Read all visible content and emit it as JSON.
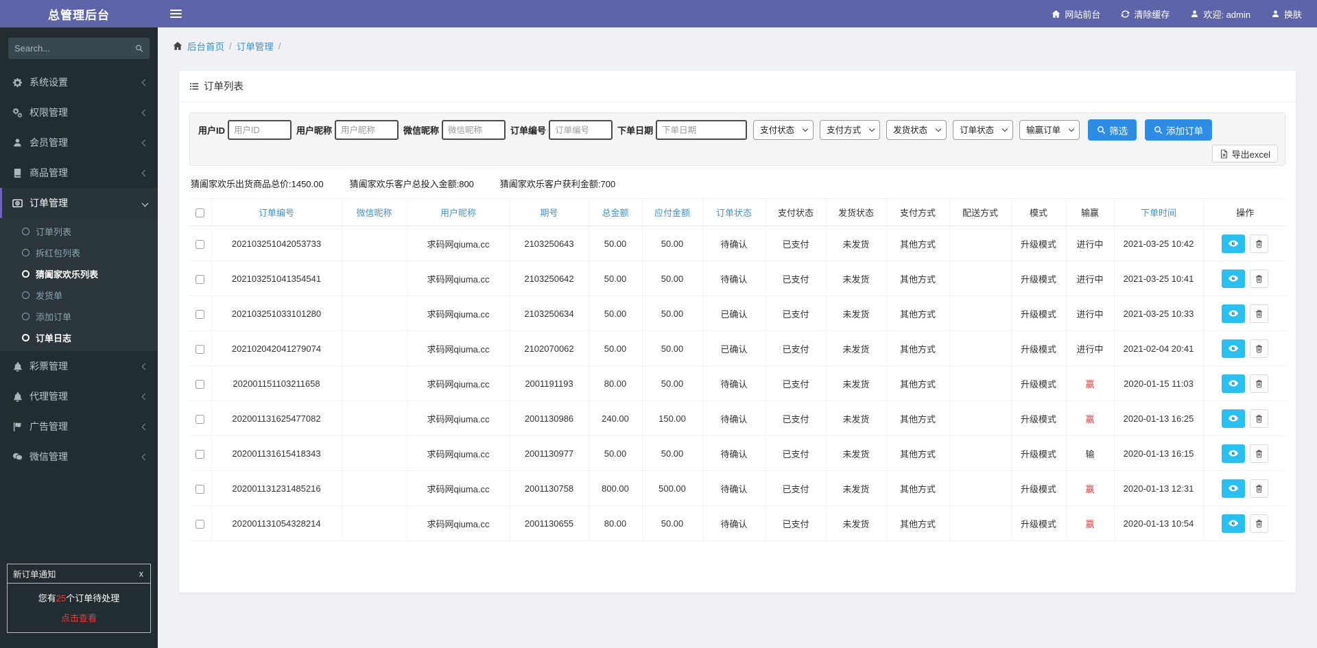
{
  "theme": {
    "topbar_purple": "#5e64a8",
    "sidebar_dark": "#222d32",
    "accent_purple": "#6f63c0",
    "link_blue": "#3d8fd0",
    "header_link_blue": "#4193d2",
    "button_blue": "#2e8ce4",
    "eye_cyan": "#29bff0",
    "alert_red": "#e53c3c"
  },
  "topbar": {
    "brand": "总管理后台",
    "nav": [
      {
        "name": "site-front-link",
        "icon": "home",
        "label": "网站前台"
      },
      {
        "name": "clear-cache-link",
        "icon": "refresh",
        "label": "清除缓存"
      },
      {
        "name": "welcome-admin",
        "icon": "person",
        "label": "欢迎: admin"
      },
      {
        "name": "change-skin-link",
        "icon": "person",
        "label": "换肤"
      }
    ]
  },
  "sidebar": {
    "search_placeholder": "Search...",
    "items": [
      {
        "name": "system-settings",
        "icon": "gear",
        "label": "系统设置",
        "active": false
      },
      {
        "name": "permission-management",
        "icon": "gears",
        "label": "权限管理",
        "active": false
      },
      {
        "name": "member-management",
        "icon": "person",
        "label": "会员管理",
        "active": false
      },
      {
        "name": "product-management",
        "icon": "book",
        "label": "商品管理",
        "active": false
      },
      {
        "name": "order-management",
        "icon": "order",
        "label": "订单管理",
        "active": true
      },
      {
        "name": "lottery-management",
        "icon": "bell",
        "label": "彩票管理",
        "active": false
      },
      {
        "name": "agent-management",
        "icon": "bell",
        "label": "代理管理",
        "active": false
      },
      {
        "name": "ad-management",
        "icon": "flag",
        "label": "广告管理",
        "active": false
      },
      {
        "name": "wechat-management",
        "icon": "wechat",
        "label": "微信管理",
        "active": false
      }
    ],
    "submenu": [
      {
        "label": "订单列表",
        "active": false
      },
      {
        "label": "拆红包列表",
        "active": false
      },
      {
        "label": "猜阖家欢乐列表",
        "active": true
      },
      {
        "label": "发货单",
        "active": false
      },
      {
        "label": "添加订单",
        "active": false
      },
      {
        "label": "订单日志",
        "active": true
      }
    ]
  },
  "notification": {
    "title": "新订单通知",
    "close_label": "x",
    "message_prefix": "您有",
    "pending_count": "25",
    "message_suffix": "个订单待处理",
    "action": "点击查看"
  },
  "breadcrumb": {
    "home": "后台首页",
    "section": "订单管理",
    "separator": "/"
  },
  "card": {
    "title": "订单列表"
  },
  "filters": {
    "fields": [
      {
        "name": "user-id",
        "label": "用户ID",
        "placeholder": "用户ID",
        "wide": false
      },
      {
        "name": "user-nickname",
        "label": "用户昵称",
        "placeholder": "用户昵称",
        "wide": false
      },
      {
        "name": "wechat-nickname",
        "label": "微信昵称",
        "placeholder": "微信昵称",
        "wide": false
      },
      {
        "name": "order-no",
        "label": "订单编号",
        "placeholder": "订单编号",
        "wide": false
      },
      {
        "name": "order-date",
        "label": "下单日期",
        "placeholder": "下单日期",
        "wide": true
      }
    ],
    "selects": [
      {
        "name": "pay-status",
        "label": "支付状态"
      },
      {
        "name": "pay-method",
        "label": "支付方式"
      },
      {
        "name": "ship-status",
        "label": "发货状态"
      },
      {
        "name": "order-status",
        "label": "订单状态"
      },
      {
        "name": "win-lose-order",
        "label": "输赢订单"
      }
    ],
    "buttons": {
      "filter": "筛选",
      "add": "添加订单",
      "export": "导出excel"
    }
  },
  "stats": [
    "猜阖家欢乐出货商品总价:1450.00",
    "猜阖家欢乐客户总投入金额:800",
    "猜阖家欢乐客户获利金额:700"
  ],
  "table": {
    "columns": [
      {
        "label": "",
        "link": false
      },
      {
        "label": "订单编号",
        "link": true
      },
      {
        "label": "微信昵称",
        "link": true
      },
      {
        "label": "用户昵称",
        "link": true
      },
      {
        "label": "期号",
        "link": true
      },
      {
        "label": "总金额",
        "link": true
      },
      {
        "label": "应付金额",
        "link": true
      },
      {
        "label": "订单状态",
        "link": true
      },
      {
        "label": "支付状态",
        "link": false
      },
      {
        "label": "发货状态",
        "link": false
      },
      {
        "label": "支付方式",
        "link": false
      },
      {
        "label": "配送方式",
        "link": false
      },
      {
        "label": "模式",
        "link": false
      },
      {
        "label": "输赢",
        "link": false
      },
      {
        "label": "下单时间",
        "link": true
      },
      {
        "label": "操作",
        "link": false
      }
    ],
    "rows": [
      {
        "order_no": "202103251042053733",
        "wechat_nick": "",
        "user_nick": "求码网qiuma.cc",
        "issue": "2103250643",
        "total": "50.00",
        "payable": "50.00",
        "order_status": "待确认",
        "pay_status": "已支付",
        "ship_status": "未发货",
        "pay_method": "其他方式",
        "delivery": "",
        "mode": "升级模式",
        "win_lose": "进行中",
        "win_red": false,
        "time": "2021-03-25 10:42"
      },
      {
        "order_no": "202103251041354541",
        "wechat_nick": "",
        "user_nick": "求码网qiuma.cc",
        "issue": "2103250642",
        "total": "50.00",
        "payable": "50.00",
        "order_status": "待确认",
        "pay_status": "已支付",
        "ship_status": "未发货",
        "pay_method": "其他方式",
        "delivery": "",
        "mode": "升级模式",
        "win_lose": "进行中",
        "win_red": false,
        "time": "2021-03-25 10:41"
      },
      {
        "order_no": "202103251033101280",
        "wechat_nick": "",
        "user_nick": "求码网qiuma.cc",
        "issue": "2103250634",
        "total": "50.00",
        "payable": "50.00",
        "order_status": "已确认",
        "pay_status": "已支付",
        "ship_status": "未发货",
        "pay_method": "其他方式",
        "delivery": "",
        "mode": "升级模式",
        "win_lose": "进行中",
        "win_red": false,
        "time": "2021-03-25 10:33"
      },
      {
        "order_no": "202102042041279074",
        "wechat_nick": "",
        "user_nick": "求码网qiuma.cc",
        "issue": "2102070062",
        "total": "50.00",
        "payable": "50.00",
        "order_status": "已确认",
        "pay_status": "已支付",
        "ship_status": "未发货",
        "pay_method": "其他方式",
        "delivery": "",
        "mode": "升级模式",
        "win_lose": "进行中",
        "win_red": false,
        "time": "2021-02-04 20:41"
      },
      {
        "order_no": "202001151103211658",
        "wechat_nick": "",
        "user_nick": "求码网qiuma.cc",
        "issue": "2001191193",
        "total": "80.00",
        "payable": "50.00",
        "order_status": "待确认",
        "pay_status": "已支付",
        "ship_status": "未发货",
        "pay_method": "其他方式",
        "delivery": "",
        "mode": "升级模式",
        "win_lose": "赢",
        "win_red": true,
        "time": "2020-01-15 11:03"
      },
      {
        "order_no": "202001131625477082",
        "wechat_nick": "",
        "user_nick": "求码网qiuma.cc",
        "issue": "2001130986",
        "total": "240.00",
        "payable": "150.00",
        "order_status": "待确认",
        "pay_status": "已支付",
        "ship_status": "未发货",
        "pay_method": "其他方式",
        "delivery": "",
        "mode": "升级模式",
        "win_lose": "赢",
        "win_red": true,
        "time": "2020-01-13 16:25"
      },
      {
        "order_no": "202001131615418343",
        "wechat_nick": "",
        "user_nick": "求码网qiuma.cc",
        "issue": "2001130977",
        "total": "50.00",
        "payable": "50.00",
        "order_status": "待确认",
        "pay_status": "已支付",
        "ship_status": "未发货",
        "pay_method": "其他方式",
        "delivery": "",
        "mode": "升级模式",
        "win_lose": "输",
        "win_red": false,
        "time": "2020-01-13 16:15"
      },
      {
        "order_no": "202001131231485216",
        "wechat_nick": "",
        "user_nick": "求码网qiuma.cc",
        "issue": "2001130758",
        "total": "800.00",
        "payable": "500.00",
        "order_status": "待确认",
        "pay_status": "已支付",
        "ship_status": "未发货",
        "pay_method": "其他方式",
        "delivery": "",
        "mode": "升级模式",
        "win_lose": "赢",
        "win_red": true,
        "time": "2020-01-13 12:31"
      },
      {
        "order_no": "202001131054328214",
        "wechat_nick": "",
        "user_nick": "求码网qiuma.cc",
        "issue": "2001130655",
        "total": "80.00",
        "payable": "50.00",
        "order_status": "待确认",
        "pay_status": "已支付",
        "ship_status": "未发货",
        "pay_method": "其他方式",
        "delivery": "",
        "mode": "升级模式",
        "win_lose": "赢",
        "win_red": true,
        "time": "2020-01-13 10:54"
      }
    ]
  }
}
